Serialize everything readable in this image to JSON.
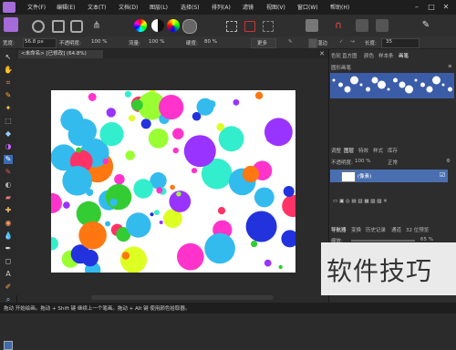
{
  "menu": {
    "items": [
      "文件(F)",
      "编辑(E)",
      "文本(T)",
      "文档(D)",
      "图层(L)",
      "选择(S)",
      "排列(A)",
      "滤镜",
      "视图(V)",
      "窗口(W)",
      "帮助(H)"
    ]
  },
  "context": {
    "width_label": "宽度:",
    "width_value": "56.8 px",
    "opacity_label": "不透明度:",
    "opacity_value": "100 %",
    "flow_label": "流量:",
    "flow_value": "100 %",
    "hardness_label": "硬度:",
    "hardness_value": "80 %",
    "more_label": "更多",
    "wet_label": "湿边",
    "length_label": "长度:",
    "length_value": "35"
  },
  "document": {
    "tab_label": "<未命名> [已修改] (64.8%)"
  },
  "panels": {
    "top_tabs": [
      "色轮",
      "直方图",
      "颜色",
      "样本条",
      "画笔"
    ],
    "brush_category": "圆形画笔",
    "layer_tabs": [
      "调整",
      "图层",
      "特效",
      "样式",
      "库存"
    ],
    "blend_opacity_label": "不透明度:",
    "blend_opacity_value": "100 %",
    "blend_mode": "正常",
    "layer_name": "(像素)",
    "nav_tabs": [
      "导航器",
      "变换",
      "历史记录",
      "通道",
      "32 位预览"
    ],
    "zoom_label": "缩放:",
    "zoom_value": "65 %"
  },
  "status": {
    "text": "拖动 开始绘画。拖动 + Shift 键 继续上一个笔画。拖动 + Alt 键 使用颜色拾取器。"
  },
  "watermark": {
    "text": "软件技巧"
  },
  "colors": {
    "accent": "#a56bd8",
    "selected_layer": "#4a6fb0",
    "brush_strip": "#3b5da8",
    "dots": [
      "#ff33cc",
      "#33cc33",
      "#99ff33",
      "#9933ff",
      "#33bbee",
      "#ff7711",
      "#2233dd",
      "#ddff22",
      "#ff3366",
      "#33eecc"
    ]
  }
}
